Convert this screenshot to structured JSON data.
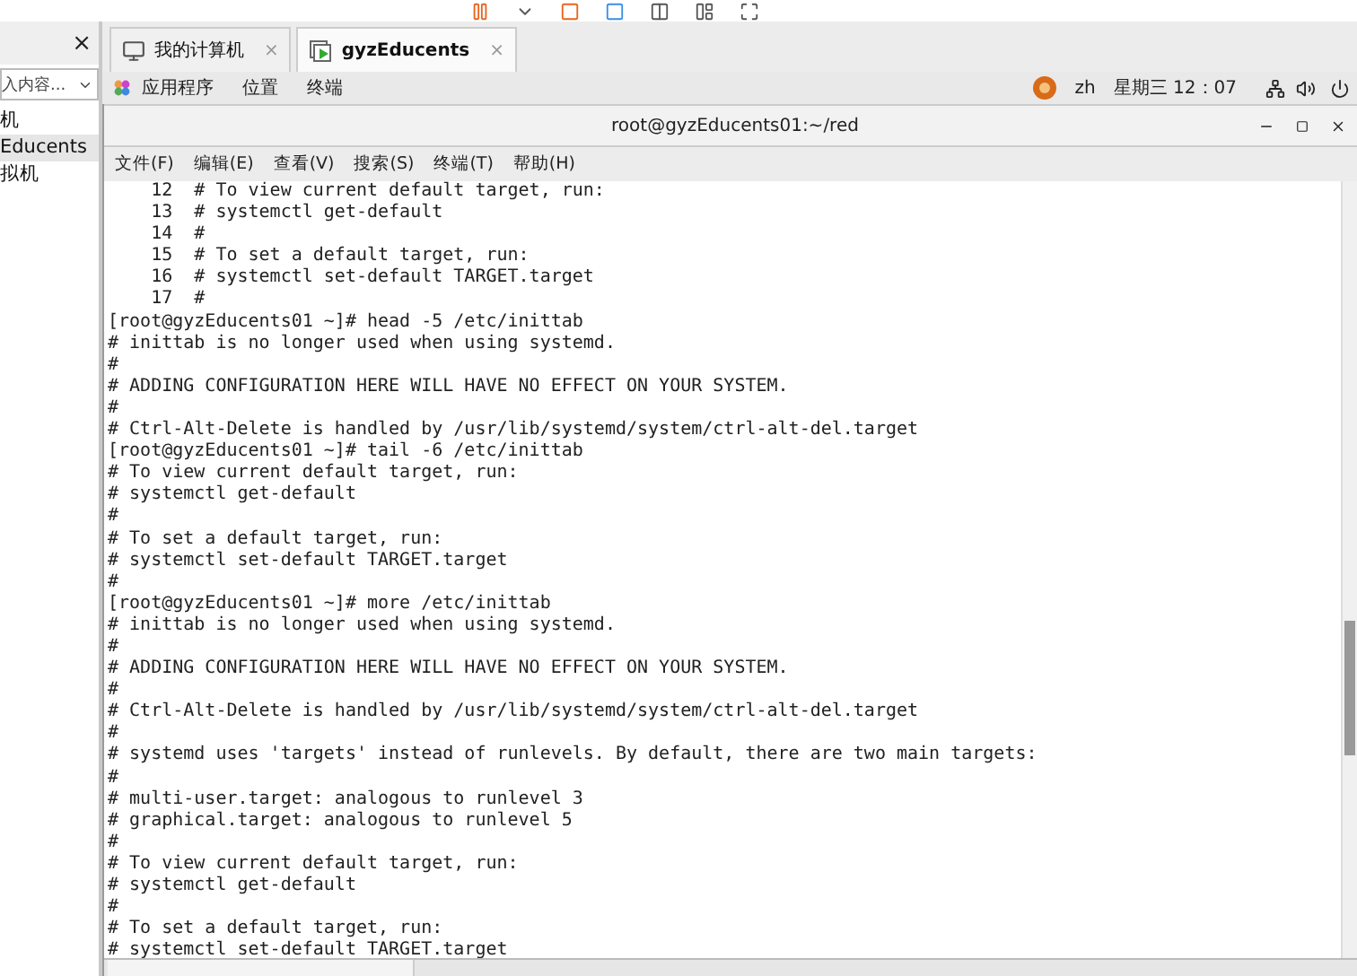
{
  "library": {
    "close": "×",
    "search": {
      "placeholder": "入内容..."
    },
    "items": [
      {
        "label": "机",
        "selected": false
      },
      {
        "label": "Educents",
        "selected": true
      },
      {
        "label": "拟机",
        "selected": false
      }
    ]
  },
  "tabs": [
    {
      "label": "我的计算机",
      "kind": "computer",
      "selected": false,
      "close": "×"
    },
    {
      "label": "gyzEducents",
      "kind": "vm",
      "selected": true,
      "close": "×"
    }
  ],
  "topbar": {
    "menus": [
      "应用程序",
      "位置",
      "终端"
    ],
    "language": "zh",
    "clock": "星期三 12：07"
  },
  "terminal": {
    "title": "root@gyzEducents01:~/red",
    "menu": [
      "文件(F)",
      "编辑(E)",
      "查看(V)",
      "搜索(S)",
      "终端(T)",
      "帮助(H)"
    ],
    "lines": [
      "    12  # To view current default target, run:",
      "    13  # systemctl get-default",
      "    14  #",
      "    15  # To set a default target, run:",
      "    16  # systemctl set-default TARGET.target",
      "    17  #",
      "[root@gyzEducents01 ~]# head -5 /etc/inittab",
      "# inittab is no longer used when using systemd.",
      "#",
      "# ADDING CONFIGURATION HERE WILL HAVE NO EFFECT ON YOUR SYSTEM.",
      "#",
      "# Ctrl-Alt-Delete is handled by /usr/lib/systemd/system/ctrl-alt-del.target",
      "[root@gyzEducents01 ~]# tail -6 /etc/inittab",
      "# To view current default target, run:",
      "# systemctl get-default",
      "#",
      "# To set a default target, run:",
      "# systemctl set-default TARGET.target",
      "#",
      "[root@gyzEducents01 ~]# more /etc/inittab",
      "# inittab is no longer used when using systemd.",
      "#",
      "# ADDING CONFIGURATION HERE WILL HAVE NO EFFECT ON YOUR SYSTEM.",
      "#",
      "# Ctrl-Alt-Delete is handled by /usr/lib/systemd/system/ctrl-alt-del.target",
      "#",
      "# systemd uses 'targets' instead of runlevels. By default, there are two main targets:",
      "#",
      "# multi-user.target: analogous to runlevel 3",
      "# graphical.target: analogous to runlevel 5",
      "#",
      "# To view current default target, run:",
      "# systemctl get-default",
      "#",
      "# To set a default target, run:",
      "# systemctl set-default TARGET.target"
    ]
  }
}
